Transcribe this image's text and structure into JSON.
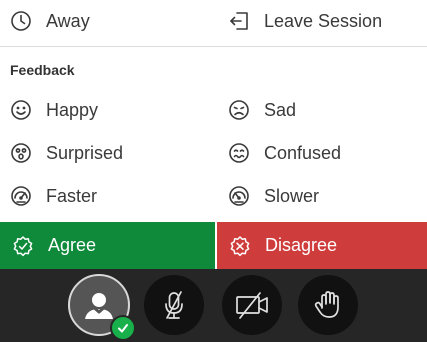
{
  "menu": {
    "away_label": "Away",
    "leave_label": "Leave Session"
  },
  "feedback": {
    "title": "Feedback",
    "items": [
      {
        "label": "Happy",
        "icon": "happy-face-icon"
      },
      {
        "label": "Sad",
        "icon": "sad-face-icon"
      },
      {
        "label": "Surprised",
        "icon": "surprised-face-icon"
      },
      {
        "label": "Confused",
        "icon": "confused-face-icon"
      },
      {
        "label": "Faster",
        "icon": "faster-gauge-icon"
      },
      {
        "label": "Slower",
        "icon": "slower-gauge-icon"
      }
    ]
  },
  "vote": {
    "agree_label": "Agree",
    "disagree_label": "Disagree",
    "agree_color": "#0f8a3a",
    "disagree_color": "#cf3c3c"
  },
  "toolbar": {
    "background": "#262626",
    "buttons": [
      {
        "icon": "user-avatar-icon",
        "status": "active"
      },
      {
        "icon": "microphone-off-icon"
      },
      {
        "icon": "camera-off-icon"
      },
      {
        "icon": "raise-hand-icon"
      }
    ]
  }
}
